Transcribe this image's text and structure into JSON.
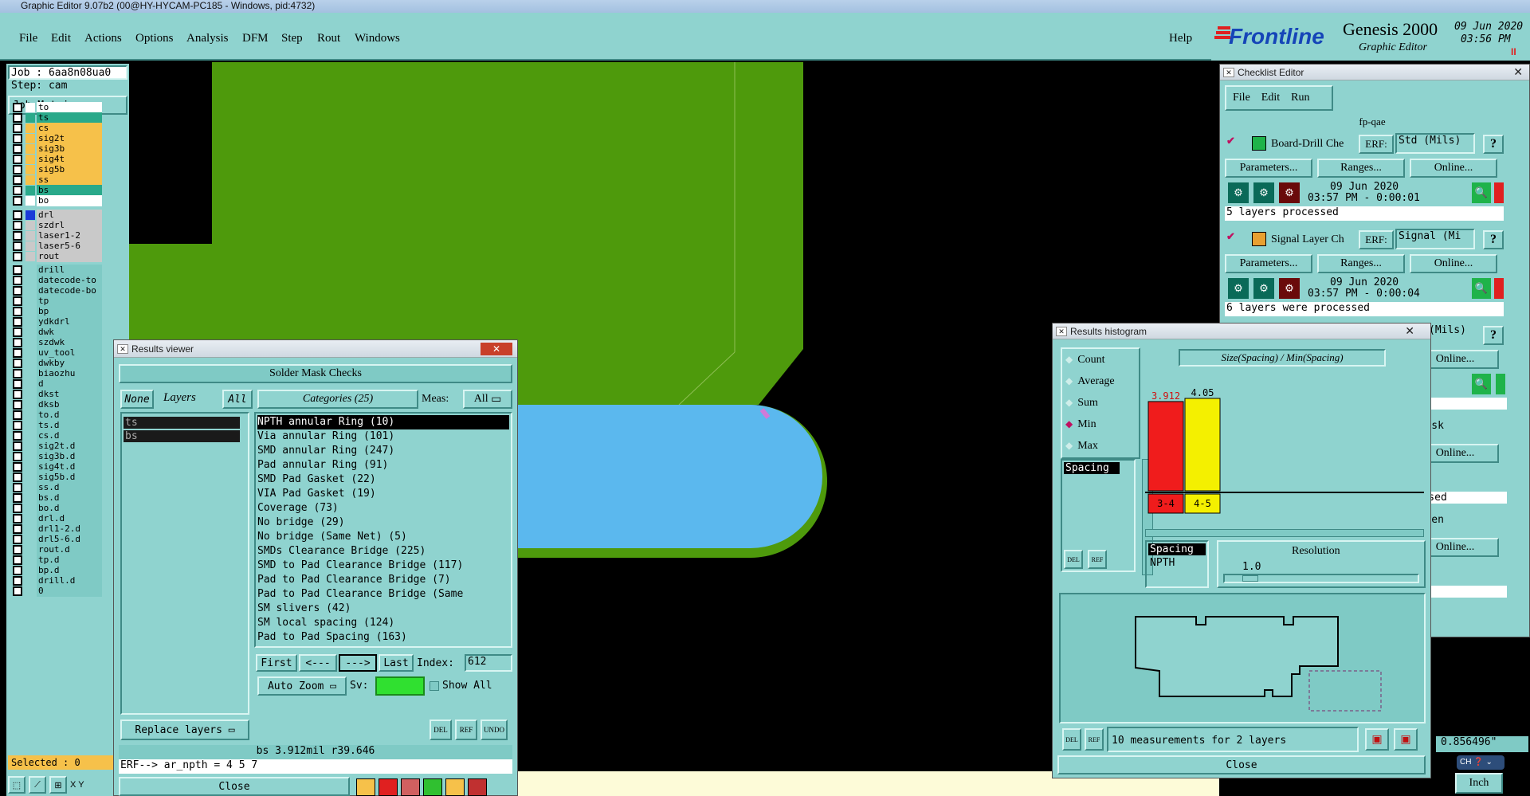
{
  "window_title": "Graphic Editor 9.07b2 (00@HY-HYCAM-PC185 - Windows, pid:4732)",
  "menu": [
    "File",
    "Edit",
    "Actions",
    "Options",
    "Analysis",
    "DFM",
    "Step",
    "Rout",
    "Windows"
  ],
  "help": "Help",
  "brand": {
    "logo": "Frontline",
    "product": "Genesis 2000",
    "subtitle": "Graphic Editor",
    "date": "09 Jun 2020",
    "time": "03:56 PM"
  },
  "job": {
    "job": "Job : 6aa8n08ua0",
    "step": "Step: cam",
    "matrix_button": "Job Matrix ..."
  },
  "layers_a": [
    {
      "name": "to",
      "color": "#ffffff"
    },
    {
      "name": "ts",
      "color": "#2aa98a"
    },
    {
      "name": "cs",
      "color": "#f6c14a"
    },
    {
      "name": "sig2t",
      "color": "#f6c14a"
    },
    {
      "name": "sig3b",
      "color": "#f6c14a"
    },
    {
      "name": "sig4t",
      "color": "#f6c14a"
    },
    {
      "name": "sig5b",
      "color": "#f6c14a"
    },
    {
      "name": "ss",
      "color": "#f6c14a"
    },
    {
      "name": "bs",
      "color": "#2aa98a"
    },
    {
      "name": "bo",
      "color": "#ffffff"
    }
  ],
  "layers_b": [
    {
      "name": "drl",
      "color": "#c9c9c9"
    },
    {
      "name": "szdrl",
      "color": "#c9c9c9"
    },
    {
      "name": "laser1-2",
      "color": "#c9c9c9"
    },
    {
      "name": "laser5-6",
      "color": "#c9c9c9"
    },
    {
      "name": "rout",
      "color": "#c9c9c9"
    }
  ],
  "layers_c": [
    "drill",
    "datecode-to",
    "datecode-bo",
    "tp",
    "bp",
    "ydkdrl",
    "dwk",
    "szdwk",
    "uv_tool",
    "dwkby",
    "biaozhu",
    "d",
    "dkst",
    "dksb",
    "to.d",
    "ts.d",
    "cs.d",
    "sig2t.d",
    "sig3b.d",
    "sig4t.d",
    "sig5b.d",
    "ss.d",
    "bs.d",
    "bo.d",
    "drl.d",
    "drl1-2.d",
    "drl5-6.d",
    "rout.d",
    "tp.d",
    "bp.d",
    "drill.d",
    "0"
  ],
  "selected": "Selected : 0",
  "xy": "X Y",
  "results_viewer": {
    "title": "Results viewer",
    "header": "Solder Mask Checks",
    "none": "None",
    "layers": "Layers",
    "all": "All",
    "categories": "Categories (25)",
    "meas": "Meas:",
    "meas_value": "All",
    "layer_items": [
      "ts",
      "bs"
    ],
    "category_items": [
      "NPTH annular Ring (10)",
      "Via annular Ring (101)",
      "SMD annular Ring (247)",
      "Pad annular Ring (91)",
      "SMD Pad Gasket (22)",
      "VIA Pad Gasket (19)",
      "Coverage (73)",
      "No bridge (29)",
      "No bridge (Same Net) (5)",
      "SMDs Clearance Bridge (225)",
      "SMD to Pad Clearance Bridge (117)",
      "Pad to Pad Clearance Bridge (7)",
      "Pad to Pad Clearance Bridge (Same",
      "SM slivers (42)",
      "SM local spacing (124)",
      "Pad to Pad Spacing (163)"
    ],
    "first": "First",
    "prev": "<---",
    "next": "--->",
    "last": "Last",
    "index_label": "Index:",
    "index_value": "612",
    "auto_zoom": "Auto Zoom",
    "sv": "Sv:",
    "show_all": "Show All",
    "replace_layers": "Replace layers",
    "status": "bs 3.912mil  r39.646",
    "erf": "ERF--> ar_npth = 4 5 7",
    "close": "Close"
  },
  "histogram": {
    "title": "Results histogram",
    "options": [
      "Count",
      "Average",
      "Sum",
      "Min",
      "Max"
    ],
    "selected_option": "Min",
    "list_item": "Spacing",
    "chart_title": "Size(Spacing) / Min(Spacing)",
    "bars": [
      {
        "value": "3.912",
        "bin": "3-4",
        "color": "#f01c1c",
        "level": 0.966
      },
      {
        "value": "4.05",
        "bin": "4-5",
        "color": "#f4f000",
        "level": 1.0
      }
    ],
    "spacing": "Spacing",
    "npth": "NPTH",
    "resolution": "Resolution",
    "resolution_value": "1.0",
    "measurements": "10 measurements for 2 layers",
    "close": "Close"
  },
  "checklist": {
    "title": "Checklist Editor",
    "menu": [
      "File",
      "Edit",
      "Run"
    ],
    "name": "fp-qae",
    "checks": [
      {
        "name": "Board-Drill Che",
        "erf": "ERF:",
        "erf_value": "Std (Mils)",
        "date": "09 Jun 2020",
        "time": "03:57 PM - 0:00:01",
        "status": "5 layers processed"
      },
      {
        "name": "Signal Layer Ch",
        "erf": "ERF:",
        "erf_value": "Signal (Mi",
        "date": "09 Jun 2020",
        "time": "03:57 PM - 0:00:04",
        "status": "6 layers were processed"
      }
    ],
    "params": "Parameters...",
    "ranges": "Ranges...",
    "online": "Online...",
    "fragments": [
      "(Mils)",
      "Online...",
      "ssed",
      "ermask",
      "Online...",
      "ocessed",
      "screen",
      "Online...",
      "ed"
    ]
  },
  "coords": "0.856496\"",
  "units": "Inch",
  "lang": "CH"
}
